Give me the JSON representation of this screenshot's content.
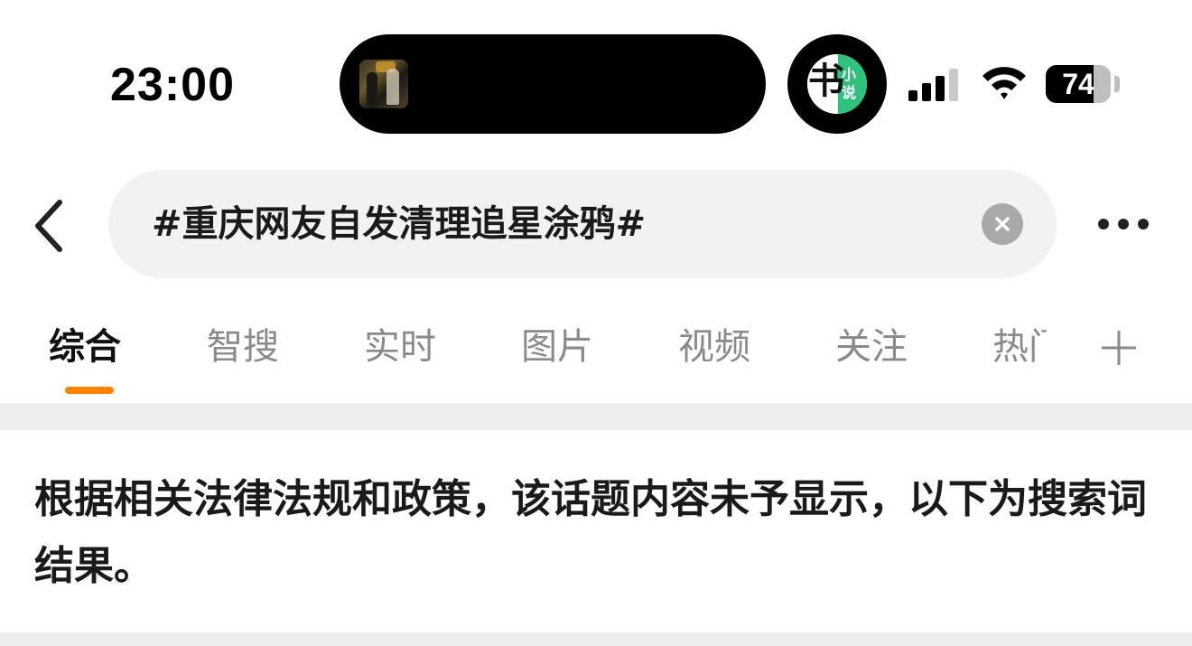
{
  "status_bar": {
    "time": "23:00",
    "battery_percent": "74",
    "battery_level": 0.74,
    "signal_bars_active": 3,
    "signal_bars_total": 4,
    "island_art_icon": "now-playing-artwork-icon",
    "app_icon_chars": {
      "big": "书",
      "small_1": "小",
      "small_2": "说"
    }
  },
  "search": {
    "query": "#重庆网友自发清理追星涂鸦#",
    "clear_icon": "clear-icon",
    "back_icon": "chevron-left-icon",
    "more_icon": "more-dots-icon"
  },
  "tabs": [
    {
      "label": "综合",
      "active": true
    },
    {
      "label": "智搜",
      "active": false
    },
    {
      "label": "实时",
      "active": false
    },
    {
      "label": "图片",
      "active": false
    },
    {
      "label": "视频",
      "active": false
    },
    {
      "label": "关注",
      "active": false
    },
    {
      "label": "热门",
      "active": false
    }
  ],
  "add_tab_icon": "plus-icon",
  "colors": {
    "accent": "#ff8200",
    "search_bg": "#f2f2f2",
    "divider": "#eeeeee",
    "inactive_tab": "#8a8a8a"
  },
  "notice": {
    "text": "根据相关法律法规和政策，该话题内容未予显示，以下为搜索词结果。"
  }
}
